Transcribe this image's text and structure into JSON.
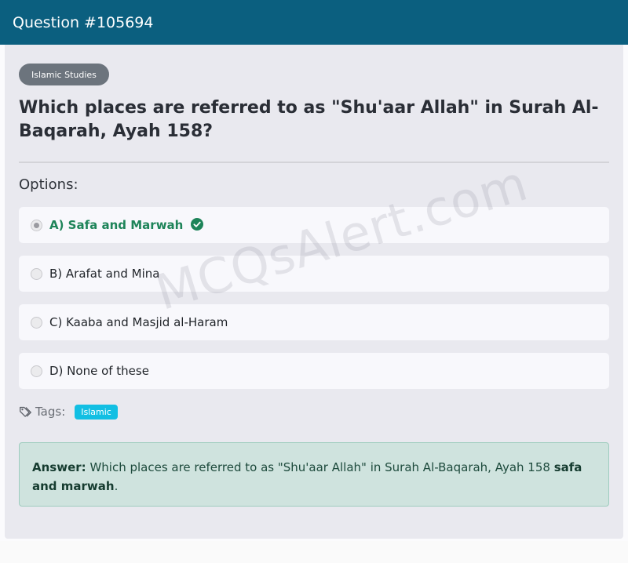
{
  "header": {
    "title": "Question #105694"
  },
  "question": {
    "category": "Islamic Studies",
    "title": "Which places are referred to as \"Shu'aar Allah\" in Surah Al-Baqarah, Ayah 158?",
    "options_heading": "Options:",
    "options": [
      {
        "label": "A) Safa and Marwah",
        "selected": true,
        "correct": true
      },
      {
        "label": "B) Arafat and Mina",
        "selected": false,
        "correct": false
      },
      {
        "label": "C) Kaaba and Masjid al-Haram",
        "selected": false,
        "correct": false
      },
      {
        "label": "D) None of these",
        "selected": false,
        "correct": false
      }
    ]
  },
  "tags": {
    "label": "Tags:",
    "items": [
      "Islamic"
    ]
  },
  "answer": {
    "prefix": "Answer:",
    "text": "Which places are referred to as \"Shu'aar Allah\" in Surah Al-Baqarah, Ayah 158",
    "answer_value": "safa and marwah",
    "suffix": "."
  },
  "watermark": "MCQsAlert.com",
  "colors": {
    "header_bg": "#0b5f7f",
    "correct_green": "#1e8459",
    "tag_blue": "#12bfe3",
    "answer_bg": "#cfe3de"
  }
}
